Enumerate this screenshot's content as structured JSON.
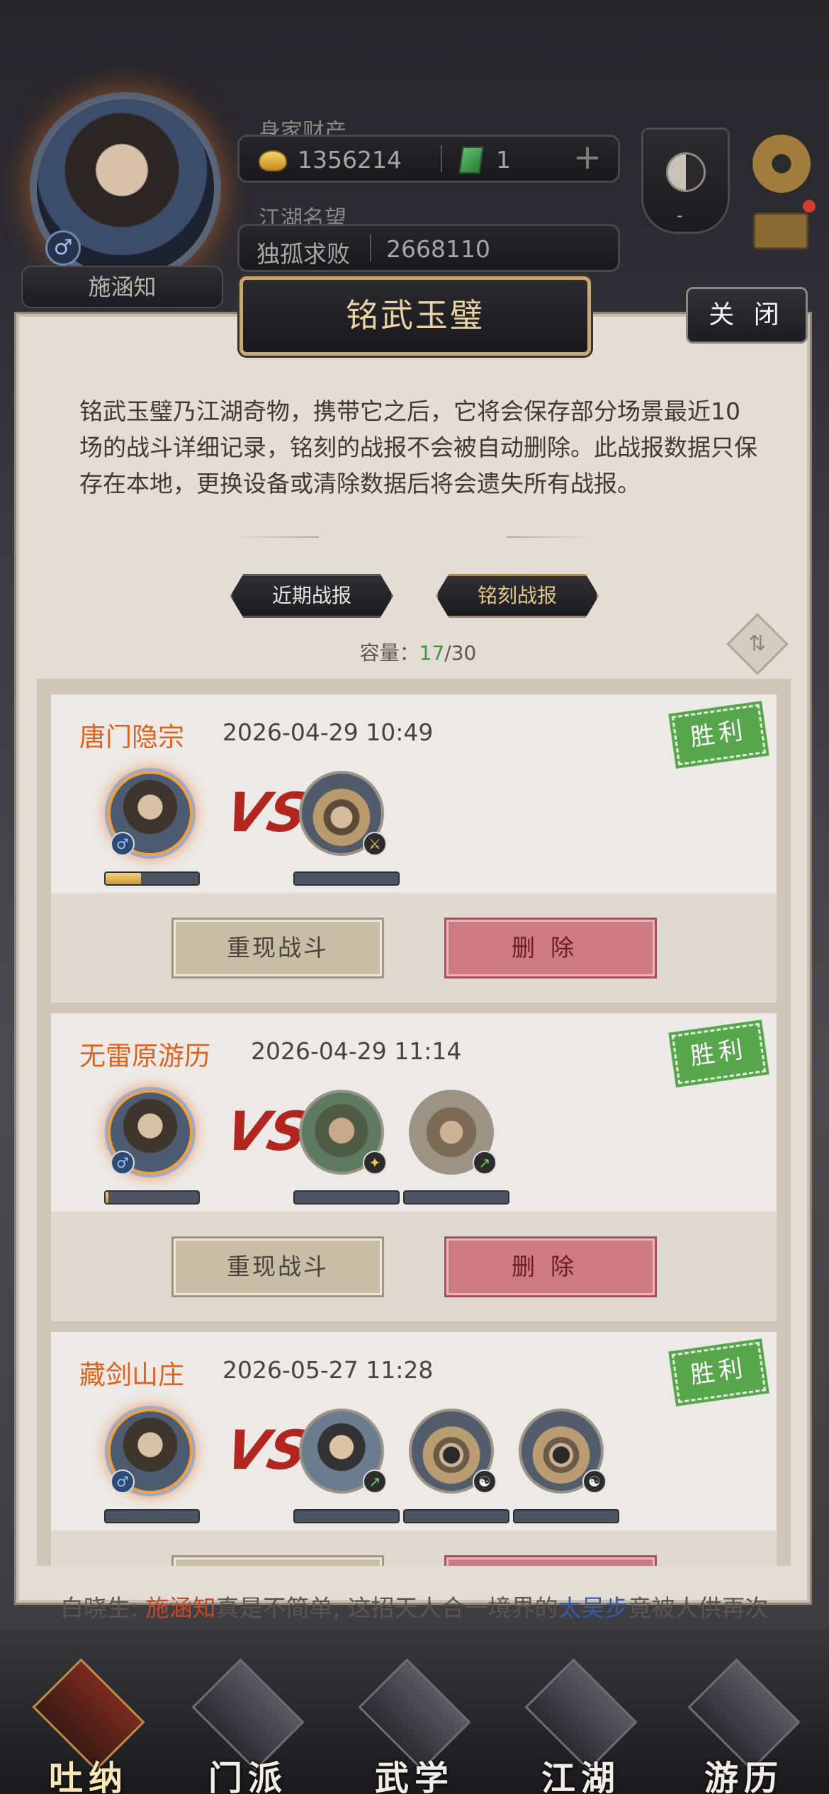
{
  "hud": {
    "player_name": "施涵知",
    "gender_symbol": "♂",
    "wealth_label": "身家财产",
    "gold": "1356214",
    "jade": "1",
    "plus": "+",
    "reputation_label": "江湖名望",
    "reputation_title": "独孤求败",
    "reputation_value": "2668110",
    "rank_text": "-"
  },
  "dialog": {
    "title": "铭武玉璧",
    "close_label": "关 闭",
    "description": "铭武玉璧乃江湖奇物，携带它之后，它将会保存部分场景最近10场的战斗详细记录，铭刻的战报不会被自动删除。此战报数据只保存在本地，更换设备或清除数据后将会遗失所有战报。",
    "tabs": [
      "近期战报",
      "铭刻战报"
    ],
    "active_tab": 1,
    "capacity_label": "容量：",
    "capacity_used": "17",
    "capacity_total": "/30",
    "vs_text": "VS",
    "result_text": "胜利",
    "replay_label": "重现战斗",
    "delete_label": "删除",
    "reports": [
      {
        "place": "唐门隐宗",
        "time": "2026-04-29 10:49",
        "hero_hp": 0.38,
        "enemies": [
          "hat-red"
        ]
      },
      {
        "place": "无雷原游历",
        "time": "2026-04-29 11:14",
        "hero_hp": 0.03,
        "enemies": [
          "bald",
          "mongol"
        ]
      },
      {
        "place": "藏剑山庄",
        "time": "2026-05-27 11:28",
        "hero_hp": 0.0,
        "enemies": [
          "young",
          "masked",
          "masked"
        ]
      }
    ]
  },
  "ticker": {
    "pre": "白晓生: ",
    "name": "施涵知",
    "mid": "真是不简单, 这招天人合一境界的",
    "skill": "太吴步",
    "post": "竟被人供再次突破，达到了前所未有的境界"
  },
  "nav": {
    "items": [
      "吐纳",
      "门派",
      "武学",
      "江湖",
      "游历"
    ],
    "active": 0
  },
  "colors": {
    "place": "#e0631d",
    "win": "#58a64b",
    "delete": "#cd7a83",
    "gold_text": "#e9d2a4"
  }
}
